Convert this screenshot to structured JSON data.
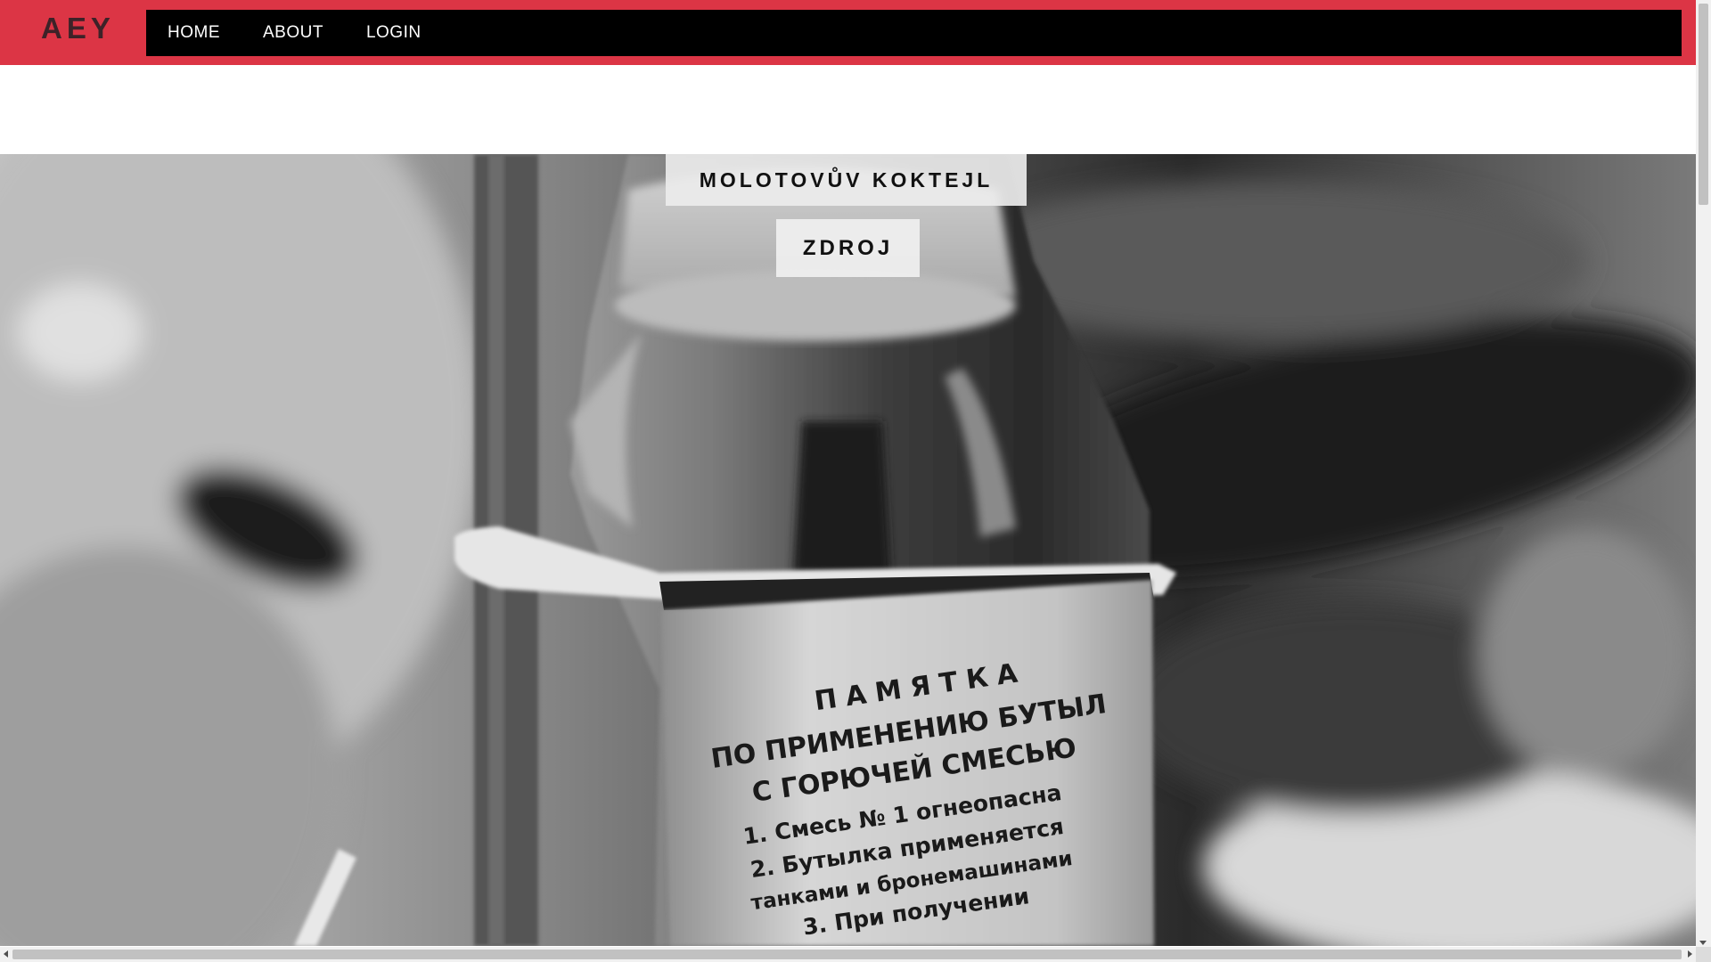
{
  "header": {
    "brand": "AEY",
    "accent_color": "#dc3545",
    "nav_background": "#000000",
    "nav": [
      {
        "label": "HOME"
      },
      {
        "label": "ABOUT"
      },
      {
        "label": "LOGIN"
      }
    ]
  },
  "hero": {
    "image": "black-and-white photo of a bottle with a printed label tied to a rod",
    "label_text": [
      "ПАМЯТКА",
      "ПО ПРИМЕНЕНИЮ БУТЫЛ",
      "С ГОРЮЧЕЙ СМЕСЬЮ",
      "1. Смесь № 1 огнеопасна",
      "2. Бутылка применяется",
      "танками и бронемашинами",
      "3. При получении"
    ],
    "title": "MOLOTOVŮV KOKTEJL",
    "source_button": "ZDROJ"
  },
  "scrollbars": {
    "vertical": "scrollbar",
    "horizontal": "scrollbar"
  }
}
